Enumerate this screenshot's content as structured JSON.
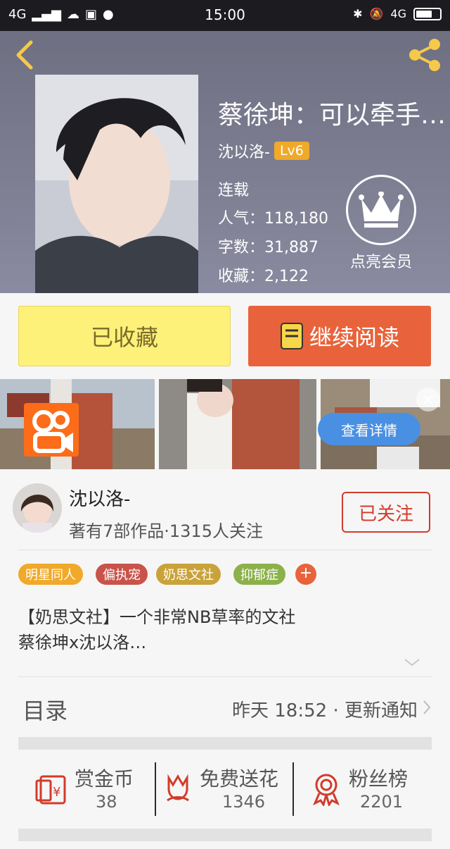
{
  "status_bar": {
    "network": "4G",
    "time": "15:00",
    "right_network": "4G"
  },
  "book": {
    "title": "蔡徐坤：可以牵手…",
    "author": "沈以洛-",
    "level": "Lv6",
    "status": "连载",
    "popularity": "人气：118,180",
    "word_count": "字数：31,887",
    "favorites": "收藏：2,122"
  },
  "vip": {
    "label": "点亮会员"
  },
  "actions": {
    "favorite_label": "已收藏",
    "read_label": "继续阅读"
  },
  "ad": {
    "detail_label": "查看详情",
    "close_label": "×"
  },
  "author_info": {
    "name": "沈以洛-",
    "meta": "著有7部作品·1315人关注",
    "follow_label": "已关注"
  },
  "tags": [
    {
      "label": "明星同人",
      "color": "#f0a929"
    },
    {
      "label": "偏执宠",
      "color": "#c9534a"
    },
    {
      "label": "奶思文社",
      "color": "#c9a23a"
    },
    {
      "label": "抑郁症",
      "color": "#8cb14a"
    }
  ],
  "tag_add_label": "+",
  "description": {
    "line1": "【奶思文社】一个非常NB草率的文社",
    "line2": "蔡徐坤x沈以洛…"
  },
  "catalog": {
    "title": "目录",
    "update": "昨天 18:52 · 更新通知"
  },
  "bottom_stats": [
    {
      "label": "赏金币",
      "value": "38",
      "icon": "red-envelope-icon"
    },
    {
      "label": "免费送花",
      "value": "1346",
      "icon": "flower-icon"
    },
    {
      "label": "粉丝榜",
      "value": "2201",
      "icon": "medal-icon"
    }
  ],
  "colors": {
    "accent_orange": "#e8633b",
    "fav_yellow": "#fef17a",
    "follow_red": "#d23b2b"
  }
}
